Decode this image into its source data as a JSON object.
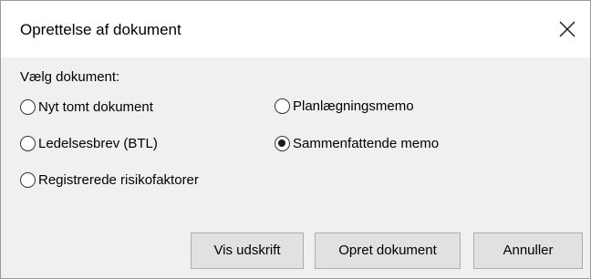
{
  "dialog": {
    "title": "Oprettelse af dokument",
    "close_icon": "close-icon"
  },
  "form": {
    "section_label": "Vælg dokument:",
    "options": [
      {
        "label": "Nyt tomt dokument",
        "selected": false
      },
      {
        "label": "Planlægningsmemo",
        "selected": false
      },
      {
        "label": "Ledelsesbrev (BTL)",
        "selected": false
      },
      {
        "label": "Sammenfattende memo",
        "selected": true
      },
      {
        "label": "Registrerede risikofaktorer",
        "selected": false
      }
    ]
  },
  "buttons": {
    "preview_label": "Vis udskrift",
    "create_label": "Opret dokument",
    "cancel_label": "Annuller"
  },
  "colors": {
    "titlebar": "#ffffff",
    "body": "#f0f0f0",
    "button": "#e1e1e1",
    "button_border": "#adadad"
  }
}
